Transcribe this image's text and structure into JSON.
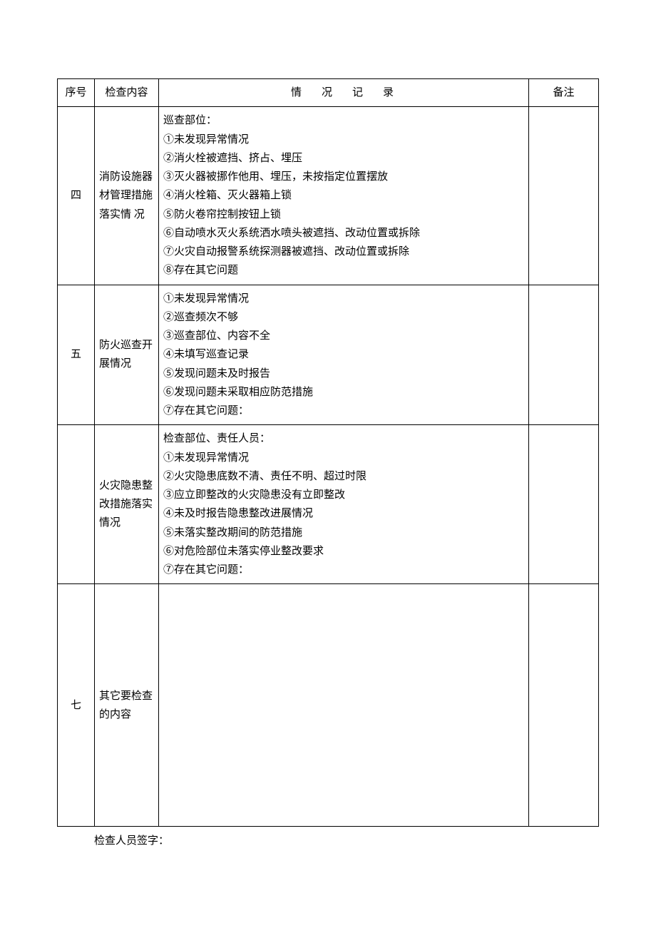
{
  "header": {
    "col_num": "序号",
    "col_content": "检查内容",
    "col_record": "情况记录",
    "col_remark": "备注"
  },
  "rows": [
    {
      "num": "四",
      "content": "消防设施器材管理措施落实情 况",
      "record": "巡查部位：\n①未发现异常情况\n②消火栓被遮挡、挤占、埋压\n③灭火器被挪作他用、埋压，未按指定位置摆放\n④消火栓箱、灭火器箱上锁\n⑤防火卷帘控制按钮上锁\n⑥自动喷水灭火系统洒水喷头被遮挡、改动位置或拆除\n⑦火灾自动报警系统探测器被遮挡、改动位置或拆除\n⑧存在其它问题",
      "remark": ""
    },
    {
      "num": "五",
      "content": "防火巡查开展情况",
      "record": "①未发现异常情况\n②巡查频次不够\n③巡查部位、内容不全\n④未填写巡查记录\n⑤发现问题未及时报告\n⑥发现问题未采取相应防范措施\n⑦存在其它问题：",
      "remark": ""
    },
    {
      "num": "",
      "content": "火灾隐患整改措施落实情况",
      "record": "检查部位、责任人员：\n①未发现异常情况\n②火灾隐患底数不清、责任不明、超过时限\n③应立即整改的火灾隐患没有立即整改\n④未及时报告隐患整改进展情况\n⑤未落实整改期间的防范措施\n⑥对危险部位未落实停业整改要求\n⑦存在其它问题：",
      "remark": ""
    },
    {
      "num": "七",
      "content": "其它要检查的内容",
      "record": "",
      "remark": ""
    }
  ],
  "footer": "检查人员签字："
}
